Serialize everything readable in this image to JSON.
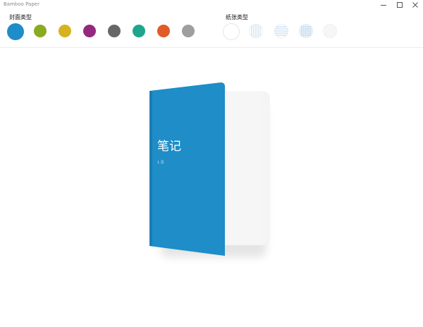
{
  "window": {
    "title": "Bamboo Paper"
  },
  "titlebar_icons": [
    "minimize-icon",
    "maximize-icon",
    "close-icon"
  ],
  "cover_section": {
    "label": "封面类型",
    "colors": [
      "#1e8dc8",
      "#8aaa1f",
      "#d6b21e",
      "#94287f",
      "#666666",
      "#1ea58c",
      "#e05a2a",
      "#9e9e9e"
    ],
    "selected_index": 0
  },
  "paper_section": {
    "label": "纸张类型",
    "types": [
      "blank",
      "vertical-lines",
      "horizontal-lines",
      "grid",
      "fine-grid"
    ],
    "selected_index": 0
  },
  "notebook": {
    "title": "笔记",
    "subtitle": "1 页",
    "cover_color": "#1e8dc8"
  }
}
